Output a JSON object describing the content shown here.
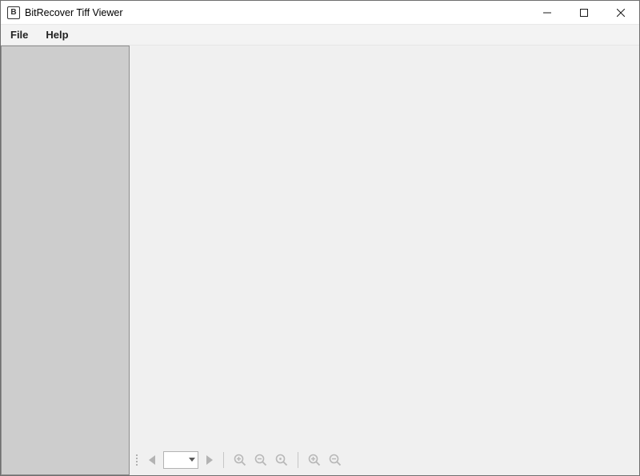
{
  "window": {
    "title": "BitRecover Tiff Viewer",
    "icon_letter": "B"
  },
  "menubar": {
    "items": [
      {
        "label": "File"
      },
      {
        "label": "Help"
      }
    ]
  },
  "toolbar": {
    "page_value": "",
    "icons": {
      "prev": "previous-page-icon",
      "next": "next-page-icon",
      "page_dropdown": "page-dropdown",
      "zoom_in": "zoom-in-icon",
      "zoom_out": "zoom-out-icon",
      "zoom_fit": "zoom-fit-icon",
      "zoom_in2": "zoom-in-icon",
      "zoom_out2": "zoom-out-icon"
    }
  }
}
